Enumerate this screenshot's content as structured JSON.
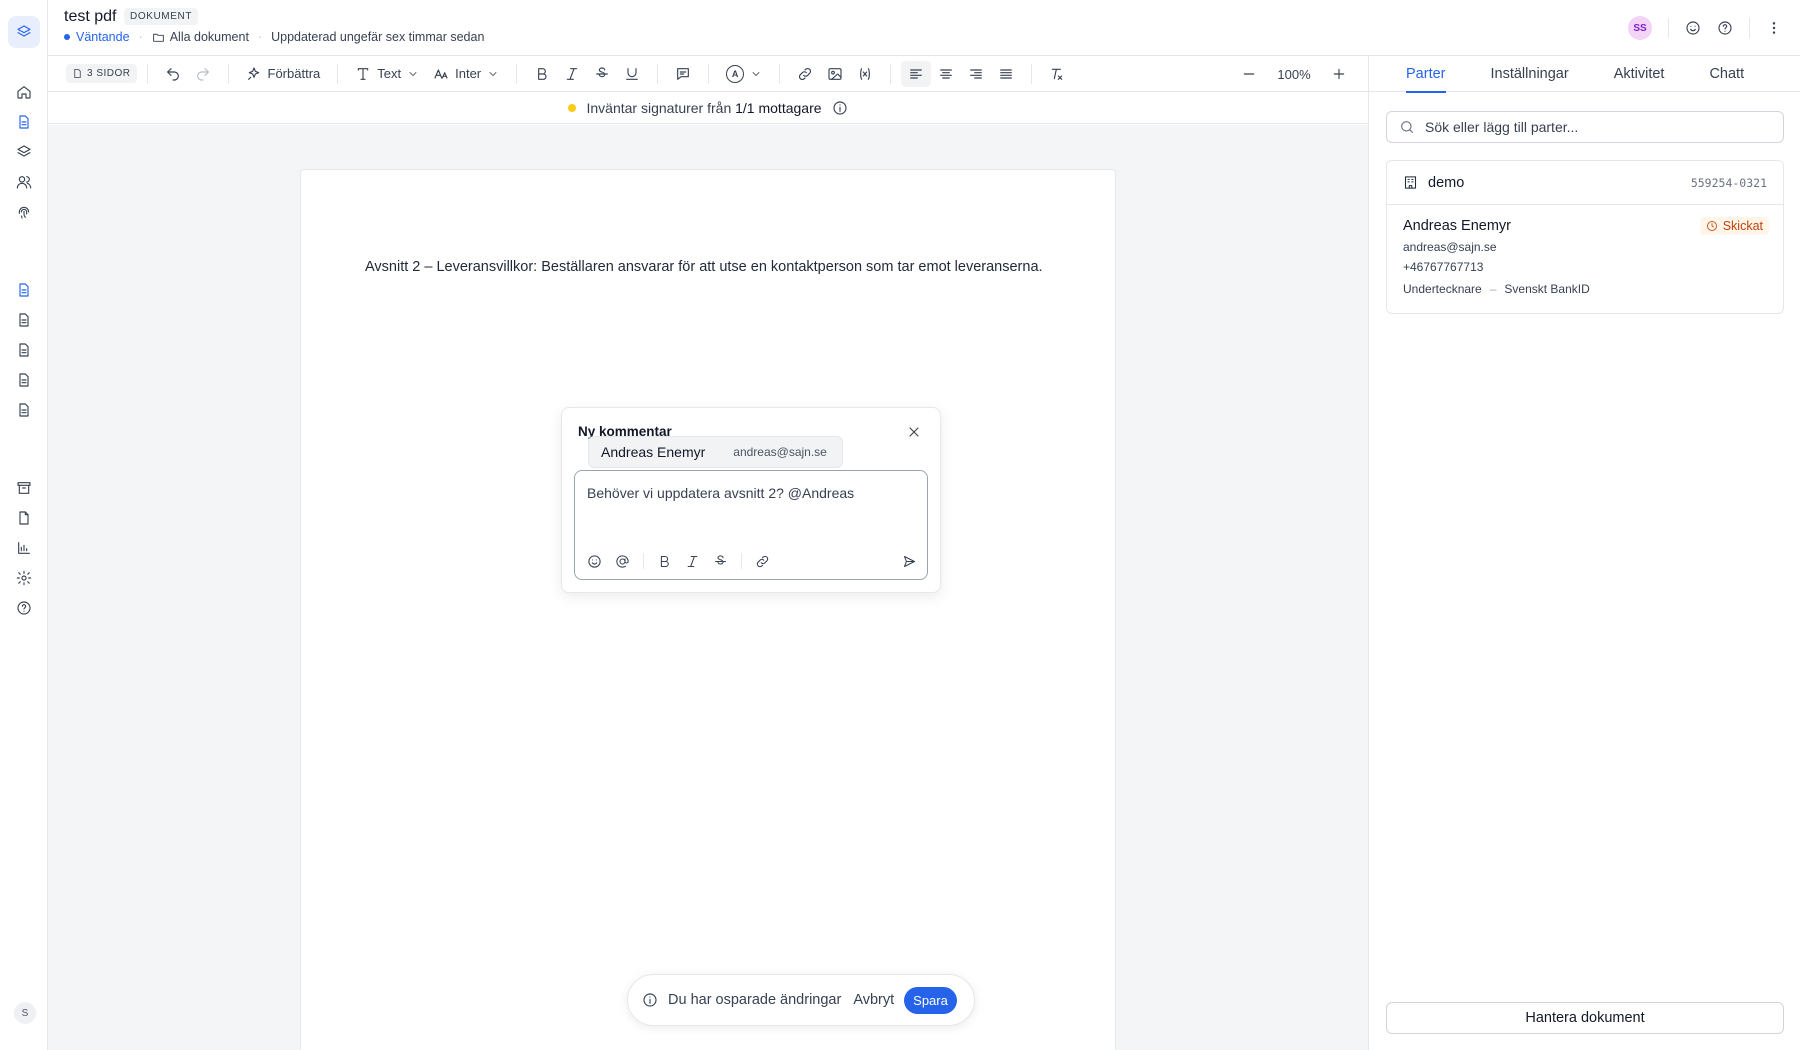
{
  "header": {
    "title": "test pdf",
    "badge": "DOKUMENT",
    "status": "Väntande",
    "folder": "Alla dokument",
    "updated": "Uppdaterad ungefär sex timmar sedan",
    "avatar_initials": "SS"
  },
  "toolbar": {
    "pages": "3 SIDOR",
    "improve": "Förbättra",
    "text_style": "Text",
    "font": "Inter",
    "color_letter": "A",
    "zoom": "100%"
  },
  "statusbar": {
    "prefix": "Inväntar signaturer från",
    "count": "1/1 mottagare"
  },
  "document": {
    "paragraph": "Avsnitt 2 – Leveransvillkor: Beställaren ansvarar för att utse en kontaktperson som tar emot leveranserna."
  },
  "comment": {
    "title": "Ny kommentar",
    "text": "Behöver vi uppdatera avsnitt 2? @Andreas",
    "mention_name": "Andreas Enemyr",
    "mention_email": "andreas@sajn.se"
  },
  "unsaved": {
    "message": "Du har osparade ändringar",
    "cancel": "Avbryt",
    "save": "Spara"
  },
  "panel": {
    "tabs": [
      "Parter",
      "Inställningar",
      "Aktivitet",
      "Chatt"
    ],
    "search_placeholder": "Sök eller lägg till parter...",
    "org_name": "demo",
    "org_number": "559254-0321",
    "person": {
      "name": "Andreas Enemyr",
      "status": "Skickat",
      "email": "andreas@sajn.se",
      "phone": "+46767767713",
      "role": "Undertecknare",
      "dash": "–",
      "method": "Svenskt BankID"
    },
    "manage": "Hantera dokument"
  },
  "user": {
    "initial": "S"
  },
  "colors": {
    "accent": "#2563eb",
    "pending": "#facc15",
    "sent": "#c2410c"
  }
}
